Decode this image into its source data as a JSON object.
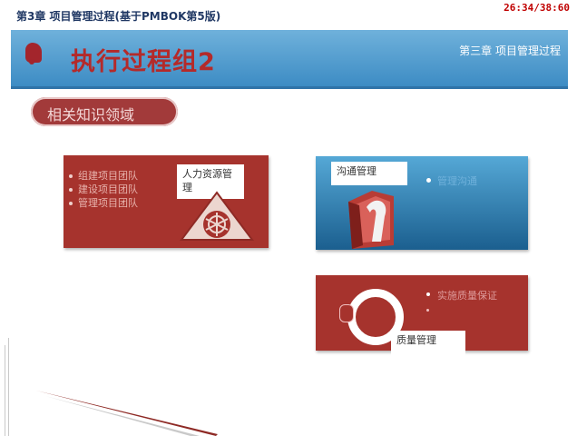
{
  "header": {
    "doc_title": "第3章 项目管理过程(基于PMBOK第5版)",
    "timer": "26:34/38:60"
  },
  "slide": {
    "title": "执行过程组2",
    "chapter": "第三章 项目管理过程",
    "section_pill": "相关知识领域"
  },
  "cards": {
    "hr": {
      "label": "人力资源管理",
      "items": [
        "组建项目团队",
        "建设项目团队",
        "管理项目团队"
      ]
    },
    "comm": {
      "label": "沟通管理",
      "item": "管理沟通"
    },
    "qual": {
      "label": "质量管理",
      "item": "实施质量保证"
    }
  },
  "colors": {
    "banner": "#4a9ad0",
    "title": "#b42a2a",
    "card_red": "#a6332d",
    "card_blue": "#2f7fb4",
    "timer": "#c00000"
  }
}
